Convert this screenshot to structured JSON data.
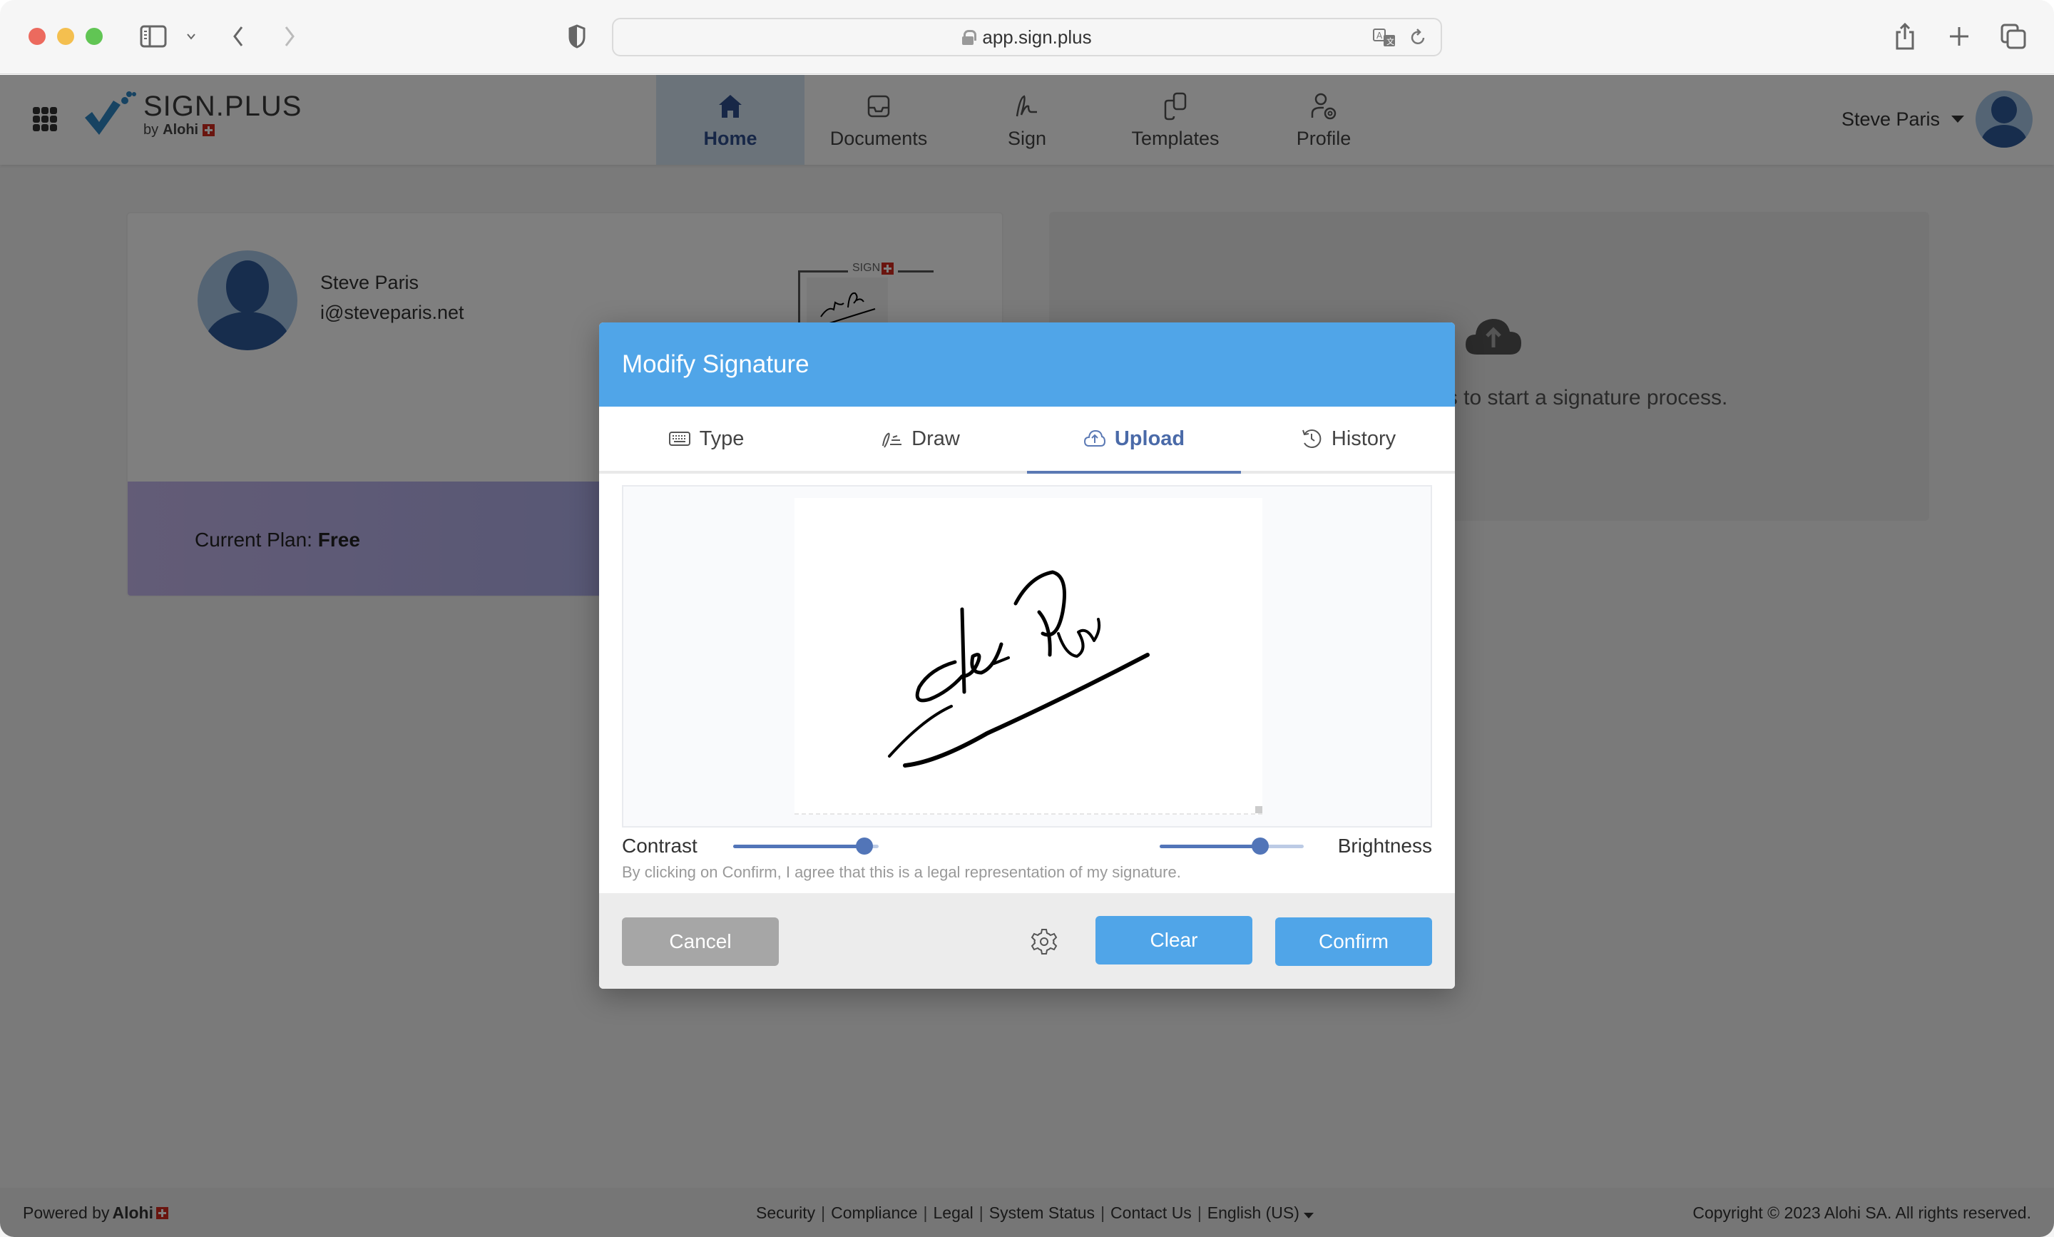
{
  "browser": {
    "url": "app.sign.plus",
    "icons": [
      "sidebar-icon",
      "chevron-down-icon",
      "back-icon",
      "forward-icon",
      "shield-icon",
      "lock-icon",
      "translate-icon",
      "reload-icon",
      "share-icon",
      "new-tab-icon",
      "tabs-overview-icon"
    ]
  },
  "app": {
    "logo": {
      "title": "SIGN.PLUS",
      "by": "by",
      "brand": "Alohi"
    },
    "nav": [
      {
        "label": "Home",
        "icon": "home-icon",
        "active": true
      },
      {
        "label": "Documents",
        "icon": "inbox-icon",
        "active": false
      },
      {
        "label": "Sign",
        "icon": "signature-icon",
        "active": false
      },
      {
        "label": "Templates",
        "icon": "templates-icon",
        "active": false
      },
      {
        "label": "Profile",
        "icon": "profile-settings-icon",
        "active": false
      }
    ],
    "user": {
      "name": "Steve Paris"
    }
  },
  "profile_card": {
    "name": "Steve Paris",
    "email": "i@steveparis.net",
    "signature_label": "SIGN",
    "plan_label": "Current Plan:",
    "plan_value": "Free"
  },
  "upload_card": {
    "text": "Drag & drop your files to start a signature process.",
    "visible_text": "rop your files to start a signature process."
  },
  "modal": {
    "title": "Modify Signature",
    "tabs": [
      {
        "label": "Type",
        "icon": "keyboard-icon",
        "active": false
      },
      {
        "label": "Draw",
        "icon": "draw-icon",
        "active": false
      },
      {
        "label": "Upload",
        "icon": "cloud-upload-icon",
        "active": true
      },
      {
        "label": "History",
        "icon": "history-icon",
        "active": false
      }
    ],
    "contrast_label": "Contrast",
    "contrast_value": 0.9,
    "brightness_label": "Brightness",
    "brightness_value": 0.7,
    "legal_note": "By clicking on Confirm, I agree that this is a legal representation of my signature.",
    "cancel_label": "Cancel",
    "clear_label": "Clear",
    "confirm_label": "Confirm"
  },
  "footer": {
    "powered_by": "Powered by",
    "brand": "Alohi",
    "links": [
      "Security",
      "Compliance",
      "Legal",
      "System Status",
      "Contact Us",
      "English (US)"
    ],
    "copyright": "Copyright © 2023 Alohi SA. All rights reserved."
  },
  "colors": {
    "accent": "#50a5e8",
    "active_tab": "#5b79b4",
    "slider": "#5275b8",
    "cancel": "#a6a6a6"
  }
}
